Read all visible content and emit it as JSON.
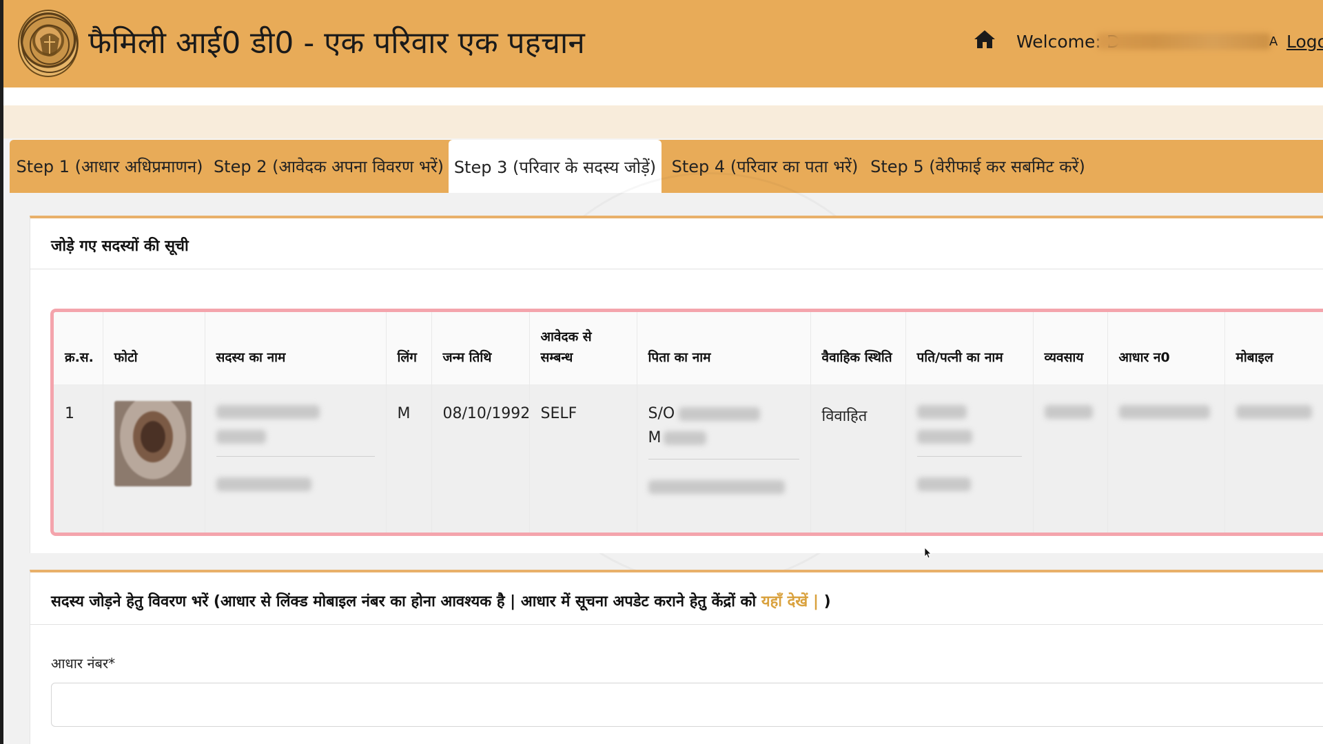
{
  "header": {
    "title": "फैमिली आई0 डी0 - एक परिवार एक पहचान",
    "welcome_label": "Welcome: D",
    "welcome_trailing": "A",
    "logout_label": "Logout",
    "brand_color": "#e8ab58"
  },
  "tabs": [
    {
      "label": "Step 1 (आधार अधिप्रमाणन)",
      "active": false
    },
    {
      "label": "Step 2 (आवेदक अपना विवरण भरें)",
      "active": false
    },
    {
      "label": "Step 3 (परिवार के सदस्य जोड़ें)",
      "active": true
    },
    {
      "label": "Step 4 (परिवार का पता भरें)",
      "active": false
    },
    {
      "label": "Step 5 (वेरीफाई कर सबमिट करें)",
      "active": false
    }
  ],
  "members_panel": {
    "heading": "जोड़े गए सदस्यों की सूची",
    "columns": {
      "serial": "क्र.स.",
      "photo": "फोटो",
      "member_name": "सदस्य का नाम",
      "gender": "लिंग",
      "dob": "जन्म तिथि",
      "relation": "आवेदक से सम्बन्ध",
      "father_name": "पिता का नाम",
      "marital_status": "वैवाहिक स्थिति",
      "spouse_name": "पति/पत्नी का नाम",
      "occupation": "व्यवसाय",
      "aadhaar": "आधार न0",
      "mobile": "मोबाइल"
    },
    "rows": [
      {
        "serial": "1",
        "gender": "M",
        "dob": "08/10/1992",
        "relation": "SELF",
        "father_prefix": "S/O",
        "father_second_initial": "M",
        "marital_status": "विवाहित"
      }
    ]
  },
  "add_member_panel": {
    "heading_text": "सदस्य जोड़ने हेतु विवरण भरें (आधार से लिंक्ड मोबाइल नंबर का होना आवश्यक है | आधार में सूचना अपडेट कराने हेतु केंद्रों को ",
    "link_text": "यहाँ देखें |",
    "heading_close": " )",
    "aadhaar_label": "आधार नंबर*",
    "aadhaar_value": ""
  }
}
